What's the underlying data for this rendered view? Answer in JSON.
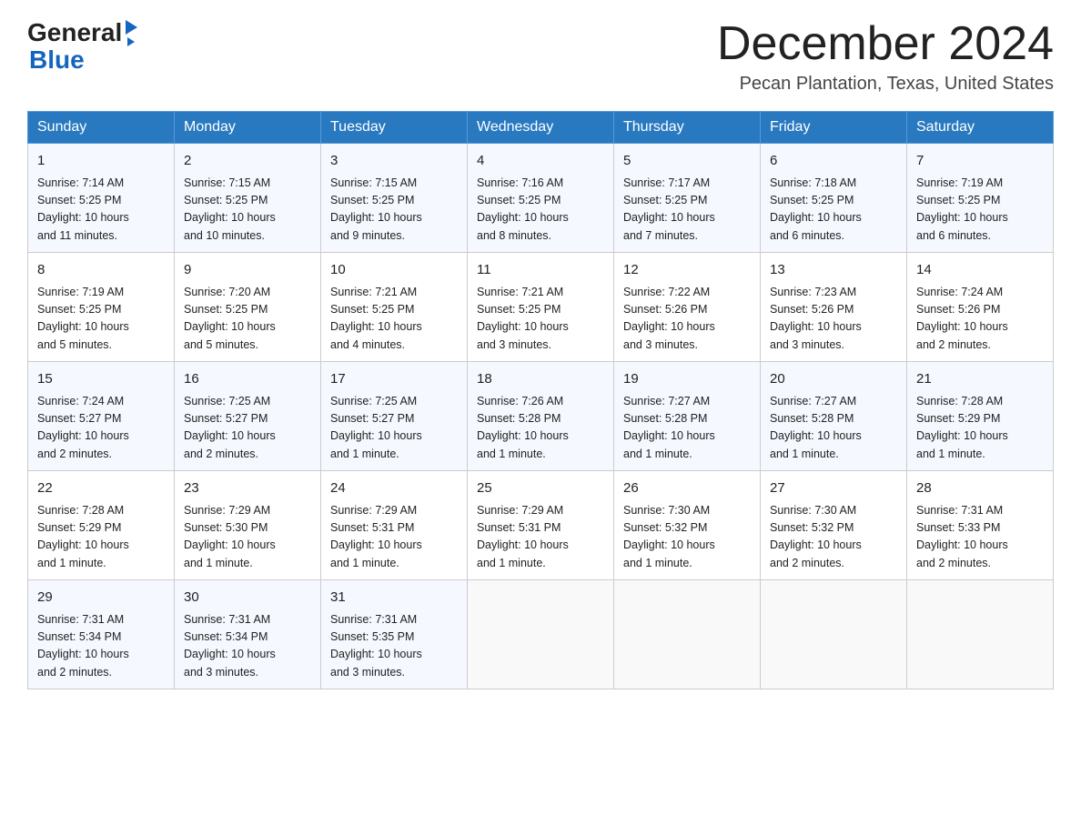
{
  "header": {
    "logo": {
      "general": "General",
      "blue": "Blue"
    },
    "title": "December 2024",
    "subtitle": "Pecan Plantation, Texas, United States"
  },
  "days_of_week": [
    "Sunday",
    "Monday",
    "Tuesday",
    "Wednesday",
    "Thursday",
    "Friday",
    "Saturday"
  ],
  "weeks": [
    [
      {
        "day": "1",
        "sunrise": "7:14 AM",
        "sunset": "5:25 PM",
        "daylight": "10 hours and 11 minutes."
      },
      {
        "day": "2",
        "sunrise": "7:15 AM",
        "sunset": "5:25 PM",
        "daylight": "10 hours and 10 minutes."
      },
      {
        "day": "3",
        "sunrise": "7:15 AM",
        "sunset": "5:25 PM",
        "daylight": "10 hours and 9 minutes."
      },
      {
        "day": "4",
        "sunrise": "7:16 AM",
        "sunset": "5:25 PM",
        "daylight": "10 hours and 8 minutes."
      },
      {
        "day": "5",
        "sunrise": "7:17 AM",
        "sunset": "5:25 PM",
        "daylight": "10 hours and 7 minutes."
      },
      {
        "day": "6",
        "sunrise": "7:18 AM",
        "sunset": "5:25 PM",
        "daylight": "10 hours and 6 minutes."
      },
      {
        "day": "7",
        "sunrise": "7:19 AM",
        "sunset": "5:25 PM",
        "daylight": "10 hours and 6 minutes."
      }
    ],
    [
      {
        "day": "8",
        "sunrise": "7:19 AM",
        "sunset": "5:25 PM",
        "daylight": "10 hours and 5 minutes."
      },
      {
        "day": "9",
        "sunrise": "7:20 AM",
        "sunset": "5:25 PM",
        "daylight": "10 hours and 5 minutes."
      },
      {
        "day": "10",
        "sunrise": "7:21 AM",
        "sunset": "5:25 PM",
        "daylight": "10 hours and 4 minutes."
      },
      {
        "day": "11",
        "sunrise": "7:21 AM",
        "sunset": "5:25 PM",
        "daylight": "10 hours and 3 minutes."
      },
      {
        "day": "12",
        "sunrise": "7:22 AM",
        "sunset": "5:26 PM",
        "daylight": "10 hours and 3 minutes."
      },
      {
        "day": "13",
        "sunrise": "7:23 AM",
        "sunset": "5:26 PM",
        "daylight": "10 hours and 3 minutes."
      },
      {
        "day": "14",
        "sunrise": "7:24 AM",
        "sunset": "5:26 PM",
        "daylight": "10 hours and 2 minutes."
      }
    ],
    [
      {
        "day": "15",
        "sunrise": "7:24 AM",
        "sunset": "5:27 PM",
        "daylight": "10 hours and 2 minutes."
      },
      {
        "day": "16",
        "sunrise": "7:25 AM",
        "sunset": "5:27 PM",
        "daylight": "10 hours and 2 minutes."
      },
      {
        "day": "17",
        "sunrise": "7:25 AM",
        "sunset": "5:27 PM",
        "daylight": "10 hours and 1 minute."
      },
      {
        "day": "18",
        "sunrise": "7:26 AM",
        "sunset": "5:28 PM",
        "daylight": "10 hours and 1 minute."
      },
      {
        "day": "19",
        "sunrise": "7:27 AM",
        "sunset": "5:28 PM",
        "daylight": "10 hours and 1 minute."
      },
      {
        "day": "20",
        "sunrise": "7:27 AM",
        "sunset": "5:28 PM",
        "daylight": "10 hours and 1 minute."
      },
      {
        "day": "21",
        "sunrise": "7:28 AM",
        "sunset": "5:29 PM",
        "daylight": "10 hours and 1 minute."
      }
    ],
    [
      {
        "day": "22",
        "sunrise": "7:28 AM",
        "sunset": "5:29 PM",
        "daylight": "10 hours and 1 minute."
      },
      {
        "day": "23",
        "sunrise": "7:29 AM",
        "sunset": "5:30 PM",
        "daylight": "10 hours and 1 minute."
      },
      {
        "day": "24",
        "sunrise": "7:29 AM",
        "sunset": "5:31 PM",
        "daylight": "10 hours and 1 minute."
      },
      {
        "day": "25",
        "sunrise": "7:29 AM",
        "sunset": "5:31 PM",
        "daylight": "10 hours and 1 minute."
      },
      {
        "day": "26",
        "sunrise": "7:30 AM",
        "sunset": "5:32 PM",
        "daylight": "10 hours and 1 minute."
      },
      {
        "day": "27",
        "sunrise": "7:30 AM",
        "sunset": "5:32 PM",
        "daylight": "10 hours and 2 minutes."
      },
      {
        "day": "28",
        "sunrise": "7:31 AM",
        "sunset": "5:33 PM",
        "daylight": "10 hours and 2 minutes."
      }
    ],
    [
      {
        "day": "29",
        "sunrise": "7:31 AM",
        "sunset": "5:34 PM",
        "daylight": "10 hours and 2 minutes."
      },
      {
        "day": "30",
        "sunrise": "7:31 AM",
        "sunset": "5:34 PM",
        "daylight": "10 hours and 3 minutes."
      },
      {
        "day": "31",
        "sunrise": "7:31 AM",
        "sunset": "5:35 PM",
        "daylight": "10 hours and 3 minutes."
      },
      null,
      null,
      null,
      null
    ]
  ],
  "labels": {
    "sunrise": "Sunrise:",
    "sunset": "Sunset:",
    "daylight": "Daylight:"
  }
}
